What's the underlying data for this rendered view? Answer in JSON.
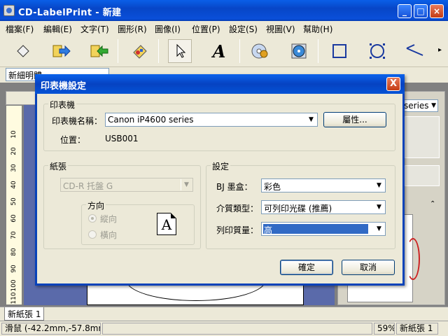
{
  "app": {
    "title": "CD-LabelPrint - 新建",
    "colors": {
      "titlebar": "#0a4fd9",
      "workspace": "#5a6aaa"
    }
  },
  "menu": [
    "檔案(F)",
    "編輯(E)",
    "文字(T)",
    "圖形(R)",
    "圖像(I)",
    "位置(P)",
    "設定(S)",
    "視圖(V)",
    "幫助(H)"
  ],
  "toolbar": {
    "tools": [
      "eraser-icon",
      "import-icon",
      "export-icon",
      "shapes-icon",
      "pointer-icon",
      "text-tool-icon",
      "cd-icon",
      "disc-icon",
      "rectangle-icon",
      "ellipse-icon",
      "line-icon"
    ]
  },
  "format": {
    "font": "新細明體"
  },
  "ruler": {
    "marks": [
      "10",
      "20",
      "30",
      "40",
      "50",
      "60",
      "70",
      "80",
      "90",
      "100",
      "110"
    ]
  },
  "right_panel": {
    "combo": "series"
  },
  "tabs": [
    "新紙張 1"
  ],
  "status": {
    "cursor": "滑鼠 (-42.2mm,-57.8mm)",
    "zoom": "59%",
    "sheet": "新紙張 1"
  },
  "dialog": {
    "title": "印表機設定",
    "close": "X",
    "printer_group": "印表機",
    "printer_name_label": "印表機名稱：",
    "printer_name": "Canon iP4600 series",
    "properties_button": "屬性...",
    "location_label": "位置：",
    "location": "USB001",
    "paper_group": "紙張",
    "paper": "CD-R 托盤 G",
    "orientation_group": "方向",
    "portrait": "縱向",
    "landscape": "橫向",
    "preview_letter": "A",
    "settings_group": "設定",
    "ink_label": "BJ 墨盒：",
    "ink": "彩色",
    "media_label": "介質類型：",
    "media": "可列印光碟 (推薦)",
    "quality_label": "列印質量：",
    "quality": "高",
    "ok_button": "確定",
    "cancel_button": "取消"
  }
}
